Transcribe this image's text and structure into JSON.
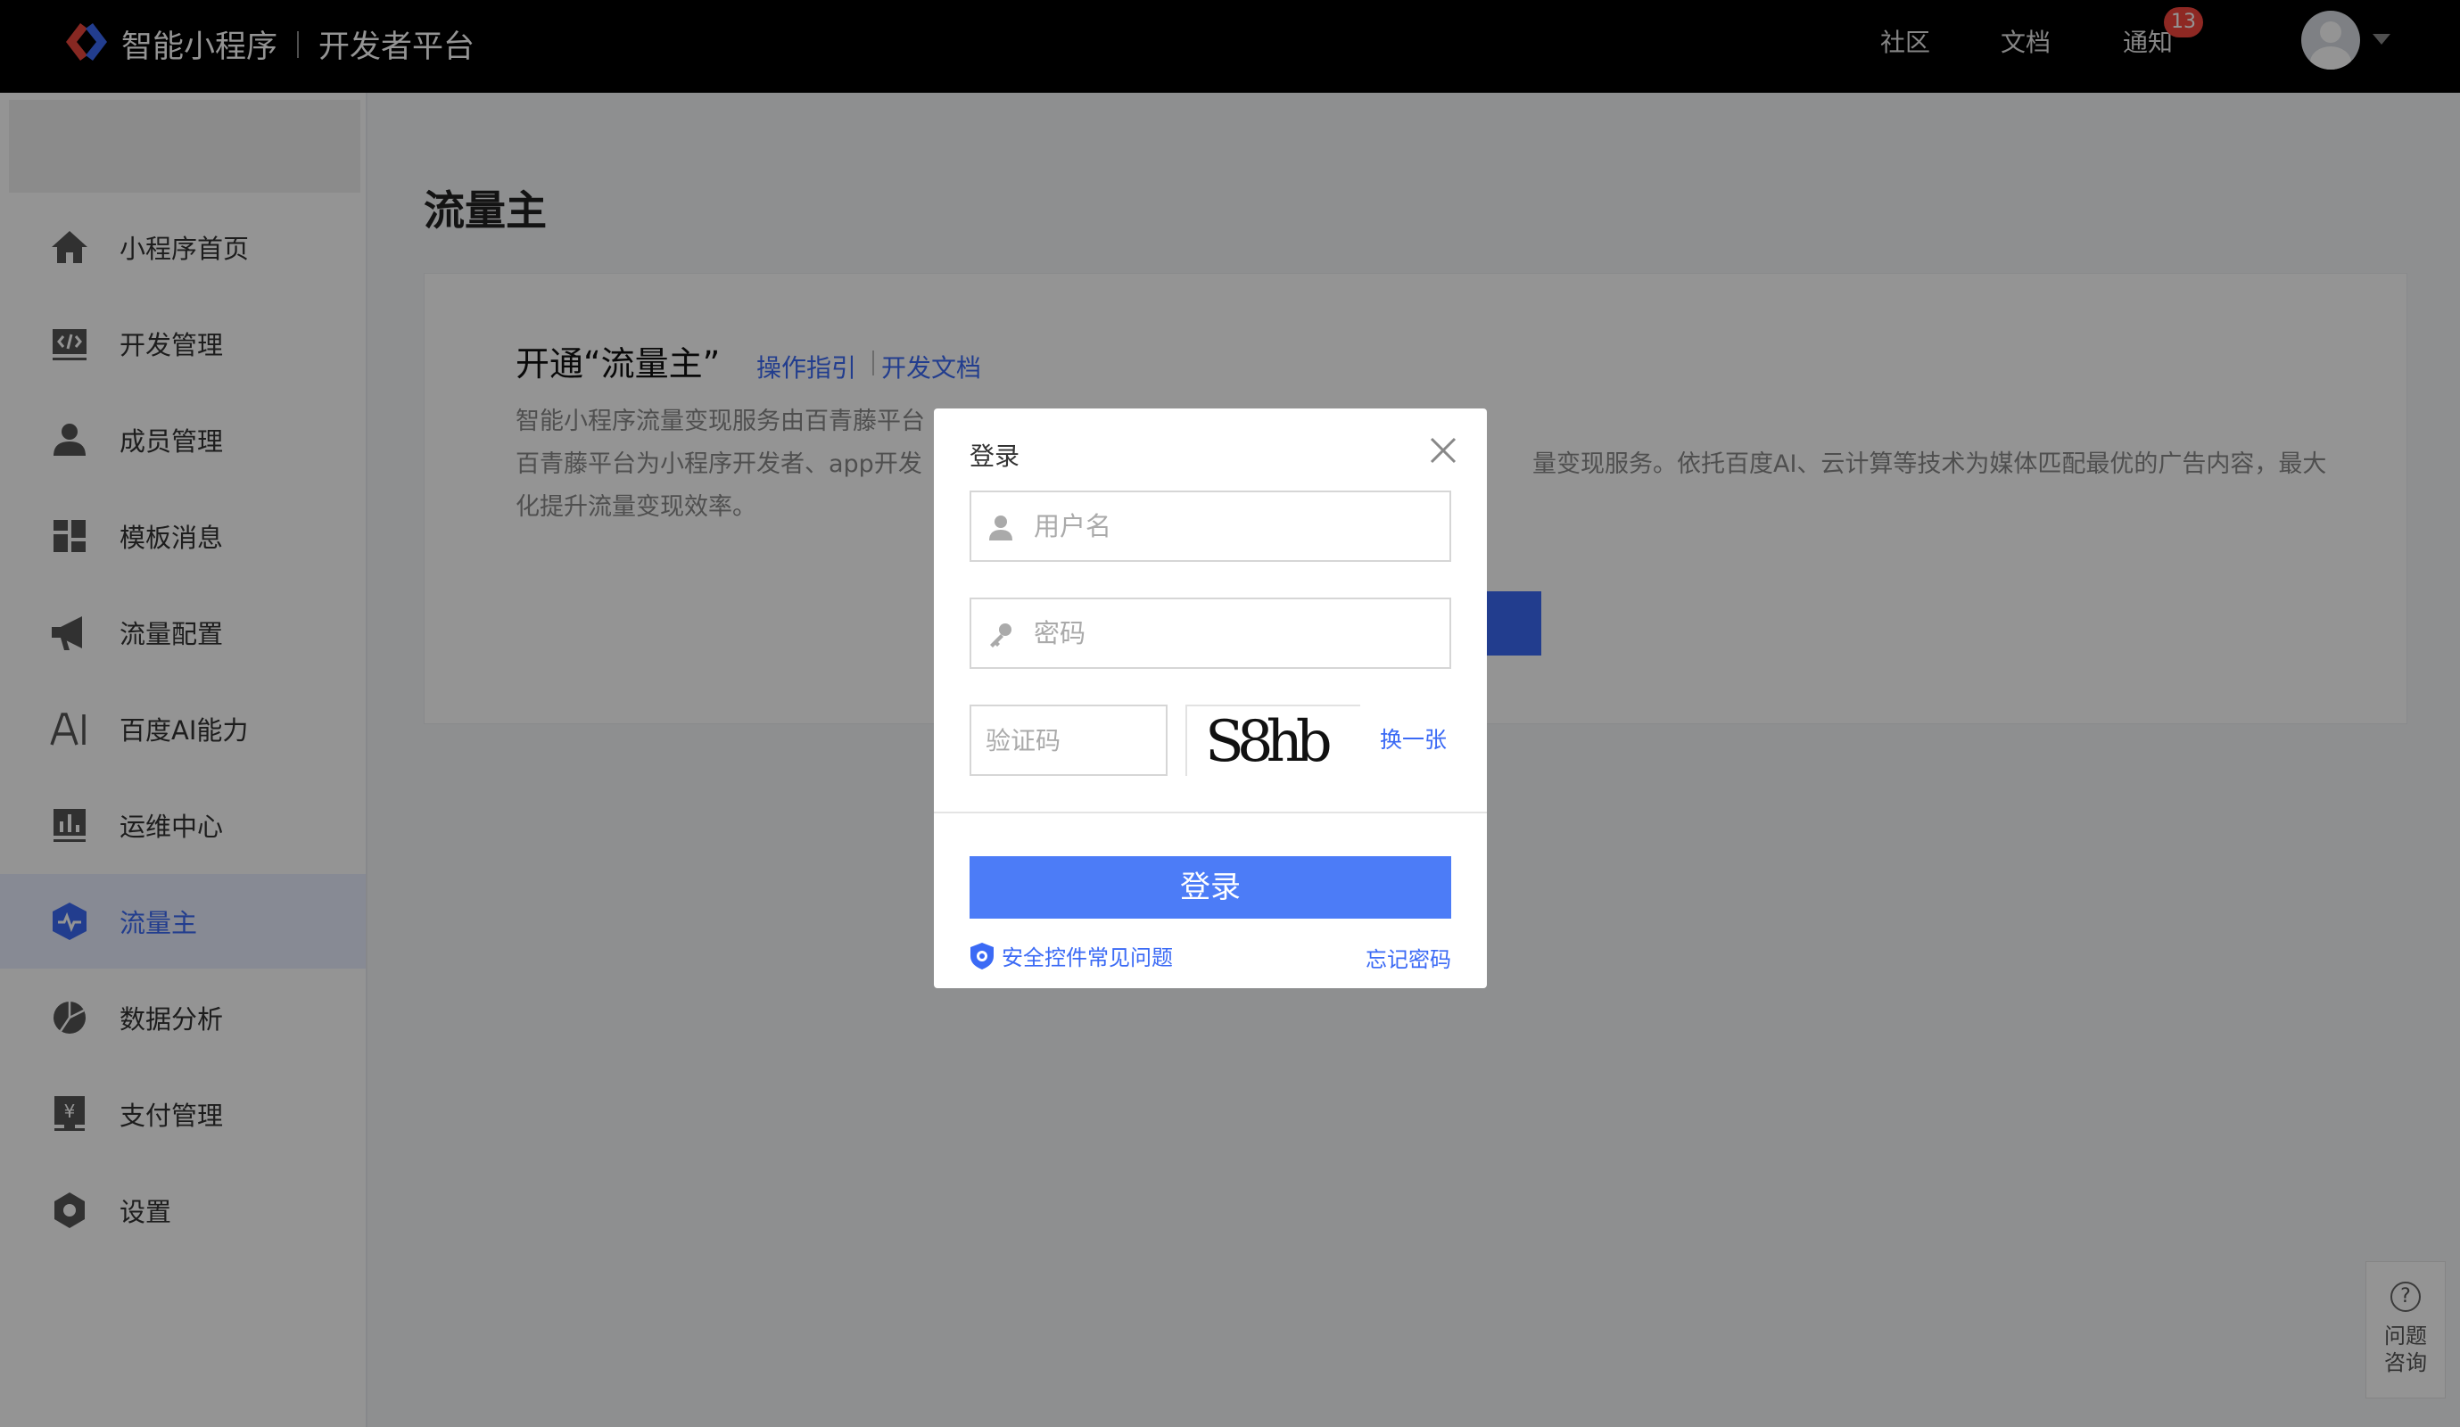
{
  "header": {
    "brand_name": "智能小程序",
    "platform_name": "开发者平台",
    "nav": [
      "社区",
      "文档",
      "通知"
    ],
    "notification_count": "13"
  },
  "sidebar": {
    "items": [
      {
        "label": "小程序首页",
        "icon": "home-icon"
      },
      {
        "label": "开发管理",
        "icon": "code-icon"
      },
      {
        "label": "成员管理",
        "icon": "user-icon"
      },
      {
        "label": "模板消息",
        "icon": "template-icon"
      },
      {
        "label": "流量配置",
        "icon": "megaphone-icon"
      },
      {
        "label": "百度AI能力",
        "icon": "ai-icon"
      },
      {
        "label": "运维中心",
        "icon": "bar-chart-icon"
      },
      {
        "label": "流量主",
        "icon": "traffic-shield-icon",
        "active": true
      },
      {
        "label": "数据分析",
        "icon": "pie-chart-icon"
      },
      {
        "label": "支付管理",
        "icon": "payment-icon"
      },
      {
        "label": "设置",
        "icon": "settings-icon"
      }
    ]
  },
  "main": {
    "page_title": "流量主",
    "card": {
      "title": "开通“流量主”",
      "link_guide": "操作指引",
      "link_docs": "开发文档",
      "description_line1": "智能小程序流量变现服务由百青藤平台",
      "description_line2_left": "百青藤平台为小程序开发者、app开发",
      "description_line2_right": "量变现服务。依托百度AI、云计算等技术为媒体匹配最优的广告内容，最大",
      "description_line3": "化提升流量变现效率。"
    }
  },
  "help_widget": {
    "line1": "问题",
    "line2": "咨询"
  },
  "login_modal": {
    "title": "登录",
    "username_placeholder": "用户名",
    "password_placeholder": "密码",
    "captcha_placeholder": "验证码",
    "captcha_text": "S8hb",
    "refresh_label": "换一张",
    "submit_label": "登录",
    "security_faq": "安全控件常见问题",
    "forgot_password": "忘记密码"
  },
  "colors": {
    "accent": "#3b6af5",
    "topbar": "#000000",
    "badge": "#f5453d"
  }
}
